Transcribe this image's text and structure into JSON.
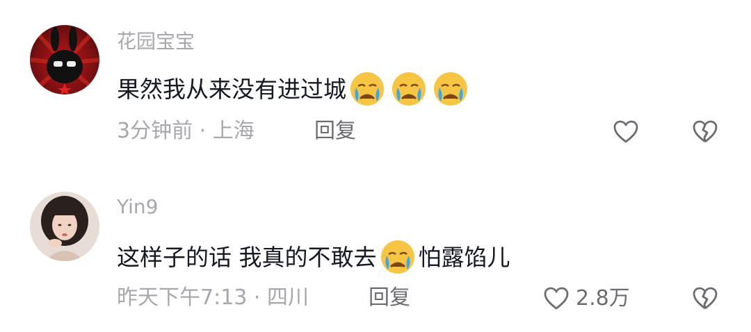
{
  "comments": [
    {
      "username": "花园宝宝",
      "content_before": "果然我从来没有进过城",
      "content_after": "",
      "emojis": [
        "crying-emoji",
        "crying-emoji",
        "crying-emoji"
      ],
      "meta": "3分钟前 · 上海",
      "reply_label": "回复",
      "like_count": "",
      "avatar": "black-rabbit-avatar"
    },
    {
      "username": "Yin9",
      "content_before": "这样子的话 我真的不敢去",
      "content_after": "怕露馅儿",
      "emojis": [
        "crying-emoji"
      ],
      "meta": "昨天下午7:13 · 四川",
      "reply_label": "回复",
      "like_count": "2.8万",
      "avatar": "girl-photo-avatar"
    }
  ],
  "colors": {
    "text_primary": "#161823",
    "text_secondary": "#a7a7ad",
    "icon": "#6b6b72"
  }
}
